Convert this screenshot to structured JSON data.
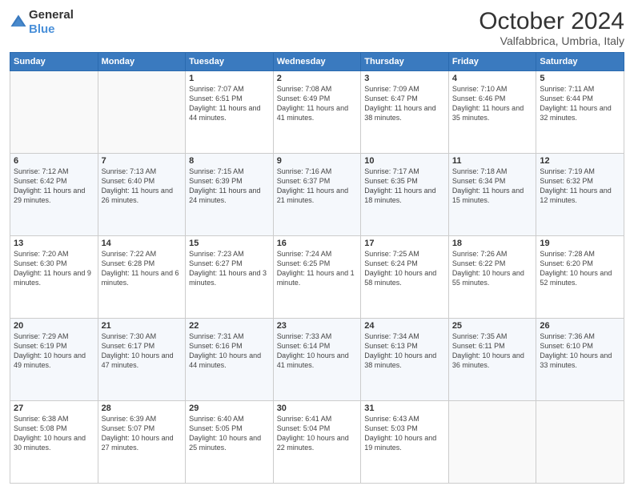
{
  "header": {
    "logo": {
      "general": "General",
      "blue": "Blue"
    },
    "title": "October 2024",
    "subtitle": "Valfabbrica, Umbria, Italy"
  },
  "days_of_week": [
    "Sunday",
    "Monday",
    "Tuesday",
    "Wednesday",
    "Thursday",
    "Friday",
    "Saturday"
  ],
  "weeks": [
    [
      {
        "day": "",
        "info": ""
      },
      {
        "day": "",
        "info": ""
      },
      {
        "day": "1",
        "info": "Sunrise: 7:07 AM\nSunset: 6:51 PM\nDaylight: 11 hours and 44 minutes."
      },
      {
        "day": "2",
        "info": "Sunrise: 7:08 AM\nSunset: 6:49 PM\nDaylight: 11 hours and 41 minutes."
      },
      {
        "day": "3",
        "info": "Sunrise: 7:09 AM\nSunset: 6:47 PM\nDaylight: 11 hours and 38 minutes."
      },
      {
        "day": "4",
        "info": "Sunrise: 7:10 AM\nSunset: 6:46 PM\nDaylight: 11 hours and 35 minutes."
      },
      {
        "day": "5",
        "info": "Sunrise: 7:11 AM\nSunset: 6:44 PM\nDaylight: 11 hours and 32 minutes."
      }
    ],
    [
      {
        "day": "6",
        "info": "Sunrise: 7:12 AM\nSunset: 6:42 PM\nDaylight: 11 hours and 29 minutes."
      },
      {
        "day": "7",
        "info": "Sunrise: 7:13 AM\nSunset: 6:40 PM\nDaylight: 11 hours and 26 minutes."
      },
      {
        "day": "8",
        "info": "Sunrise: 7:15 AM\nSunset: 6:39 PM\nDaylight: 11 hours and 24 minutes."
      },
      {
        "day": "9",
        "info": "Sunrise: 7:16 AM\nSunset: 6:37 PM\nDaylight: 11 hours and 21 minutes."
      },
      {
        "day": "10",
        "info": "Sunrise: 7:17 AM\nSunset: 6:35 PM\nDaylight: 11 hours and 18 minutes."
      },
      {
        "day": "11",
        "info": "Sunrise: 7:18 AM\nSunset: 6:34 PM\nDaylight: 11 hours and 15 minutes."
      },
      {
        "day": "12",
        "info": "Sunrise: 7:19 AM\nSunset: 6:32 PM\nDaylight: 11 hours and 12 minutes."
      }
    ],
    [
      {
        "day": "13",
        "info": "Sunrise: 7:20 AM\nSunset: 6:30 PM\nDaylight: 11 hours and 9 minutes."
      },
      {
        "day": "14",
        "info": "Sunrise: 7:22 AM\nSunset: 6:28 PM\nDaylight: 11 hours and 6 minutes."
      },
      {
        "day": "15",
        "info": "Sunrise: 7:23 AM\nSunset: 6:27 PM\nDaylight: 11 hours and 3 minutes."
      },
      {
        "day": "16",
        "info": "Sunrise: 7:24 AM\nSunset: 6:25 PM\nDaylight: 11 hours and 1 minute."
      },
      {
        "day": "17",
        "info": "Sunrise: 7:25 AM\nSunset: 6:24 PM\nDaylight: 10 hours and 58 minutes."
      },
      {
        "day": "18",
        "info": "Sunrise: 7:26 AM\nSunset: 6:22 PM\nDaylight: 10 hours and 55 minutes."
      },
      {
        "day": "19",
        "info": "Sunrise: 7:28 AM\nSunset: 6:20 PM\nDaylight: 10 hours and 52 minutes."
      }
    ],
    [
      {
        "day": "20",
        "info": "Sunrise: 7:29 AM\nSunset: 6:19 PM\nDaylight: 10 hours and 49 minutes."
      },
      {
        "day": "21",
        "info": "Sunrise: 7:30 AM\nSunset: 6:17 PM\nDaylight: 10 hours and 47 minutes."
      },
      {
        "day": "22",
        "info": "Sunrise: 7:31 AM\nSunset: 6:16 PM\nDaylight: 10 hours and 44 minutes."
      },
      {
        "day": "23",
        "info": "Sunrise: 7:33 AM\nSunset: 6:14 PM\nDaylight: 10 hours and 41 minutes."
      },
      {
        "day": "24",
        "info": "Sunrise: 7:34 AM\nSunset: 6:13 PM\nDaylight: 10 hours and 38 minutes."
      },
      {
        "day": "25",
        "info": "Sunrise: 7:35 AM\nSunset: 6:11 PM\nDaylight: 10 hours and 36 minutes."
      },
      {
        "day": "26",
        "info": "Sunrise: 7:36 AM\nSunset: 6:10 PM\nDaylight: 10 hours and 33 minutes."
      }
    ],
    [
      {
        "day": "27",
        "info": "Sunrise: 6:38 AM\nSunset: 5:08 PM\nDaylight: 10 hours and 30 minutes."
      },
      {
        "day": "28",
        "info": "Sunrise: 6:39 AM\nSunset: 5:07 PM\nDaylight: 10 hours and 27 minutes."
      },
      {
        "day": "29",
        "info": "Sunrise: 6:40 AM\nSunset: 5:05 PM\nDaylight: 10 hours and 25 minutes."
      },
      {
        "day": "30",
        "info": "Sunrise: 6:41 AM\nSunset: 5:04 PM\nDaylight: 10 hours and 22 minutes."
      },
      {
        "day": "31",
        "info": "Sunrise: 6:43 AM\nSunset: 5:03 PM\nDaylight: 10 hours and 19 minutes."
      },
      {
        "day": "",
        "info": ""
      },
      {
        "day": "",
        "info": ""
      }
    ]
  ]
}
